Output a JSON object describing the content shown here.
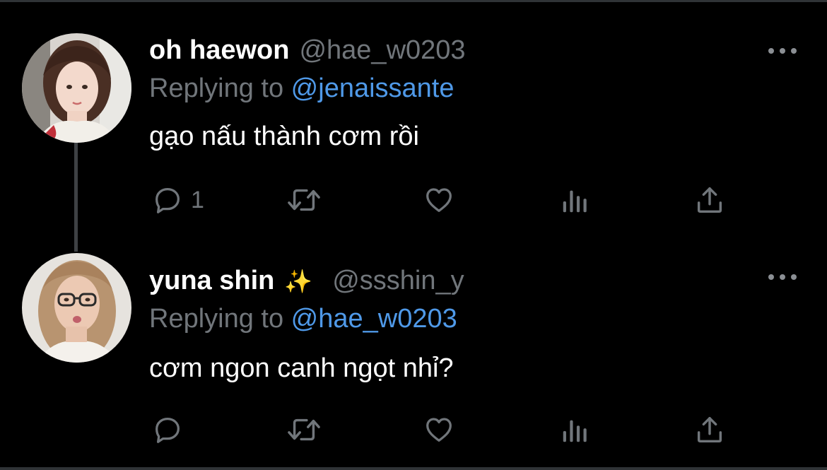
{
  "tweets": [
    {
      "display_name": "oh haewon",
      "emoji": "",
      "handle": "@hae_w0203",
      "reply_prefix": "Replying to ",
      "reply_target": "@jenaissante",
      "text": "gạo nấu thành cơm rồi",
      "reply_count": "1",
      "avatar_icon": "avatar-photo",
      "more_icon": "more-dots-icon"
    },
    {
      "display_name": "yuna shin",
      "emoji": "✨",
      "handle": "@ssshin_y",
      "reply_prefix": "Replying to ",
      "reply_target": "@hae_w0203",
      "text": "cơm ngon canh ngọt nhỉ?",
      "reply_count": "",
      "avatar_icon": "avatar-photo",
      "more_icon": "more-dots-icon"
    }
  ],
  "icons": {
    "reply": "reply-icon",
    "retweet": "retweet-icon",
    "like": "heart-icon",
    "views": "analytics-icon",
    "share": "share-icon"
  },
  "colors": {
    "background": "#000000",
    "name": "#ffffff",
    "secondary": "#71767b",
    "link": "#4f99e8",
    "thread_line": "#3e4144"
  }
}
